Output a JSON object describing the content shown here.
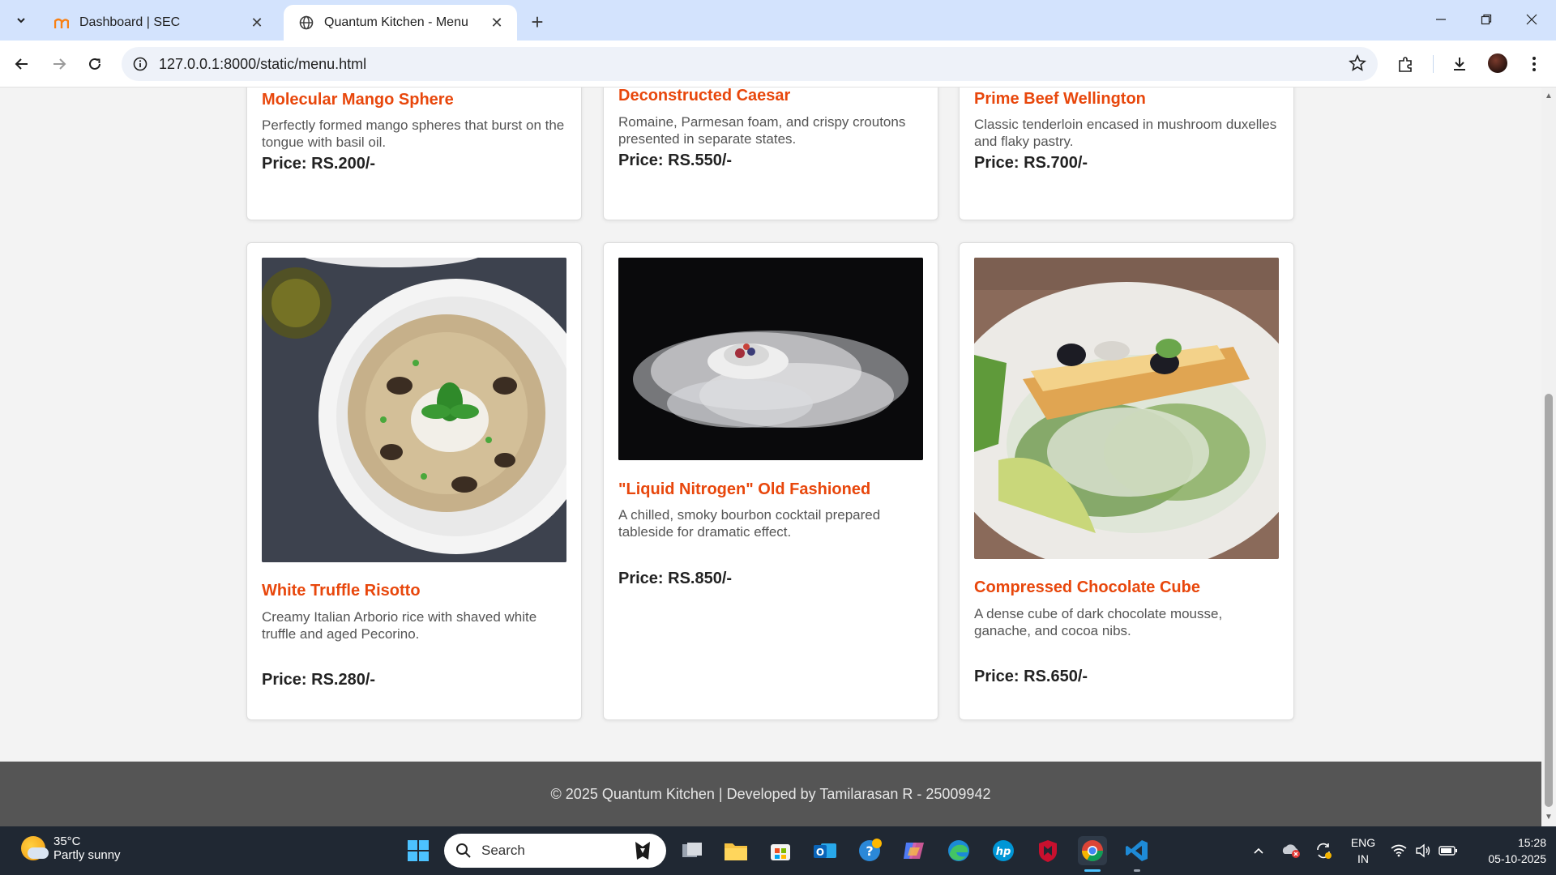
{
  "browser": {
    "tabs": [
      {
        "title": "Dashboard | SEC",
        "active": false
      },
      {
        "title": "Quantum Kitchen - Menu",
        "active": true
      }
    ],
    "url": "127.0.0.1:8000/static/menu.html"
  },
  "menu": {
    "top_row": [
      {
        "name": "Molecular Mango Sphere",
        "description": "Perfectly formed mango spheres that burst on the tongue with basil oil.",
        "price": "Price: RS.200/-"
      },
      {
        "name": "Deconstructed Caesar",
        "description": "Romaine, Parmesan foam, and crispy croutons presented in separate states.",
        "price": "Price: RS.550/-"
      },
      {
        "name": "Prime Beef Wellington",
        "description": "Classic tenderloin encased in mushroom duxelles and flaky pastry.",
        "price": "Price: RS.700/-"
      }
    ],
    "bottom_row": [
      {
        "name": "White Truffle Risotto",
        "description": "Creamy Italian Arborio rice with shaved white truffle and aged Pecorino.",
        "price": "Price: RS.280/-",
        "image": "risotto-photo"
      },
      {
        "name": "\"Liquid Nitrogen\" Old Fashioned",
        "description": "A chilled, smoky bourbon cocktail prepared tableside for dramatic effect.",
        "price": "Price: RS.850/-",
        "image": "nitrogen-cocktail-photo"
      },
      {
        "name": "Compressed Chocolate Cube",
        "description": "A dense cube of dark chocolate mousse, ganache, and cocoa nibs.",
        "price": "Price: RS.650/-",
        "image": "caesar-salad-photo"
      }
    ]
  },
  "footer": {
    "text": "© 2025 Quantum Kitchen | Developed by Tamilarasan R - 25009942"
  },
  "taskbar": {
    "weather": {
      "temp": "35°C",
      "condition": "Partly sunny"
    },
    "search_label": "Search",
    "language": {
      "line1": "ENG",
      "line2": "IN"
    },
    "time": "15:28",
    "date": "05-10-2025"
  },
  "colors": {
    "accent": "#e8470c",
    "footer_bg": "#555555",
    "tabstrip_bg": "#d3e3fd"
  }
}
